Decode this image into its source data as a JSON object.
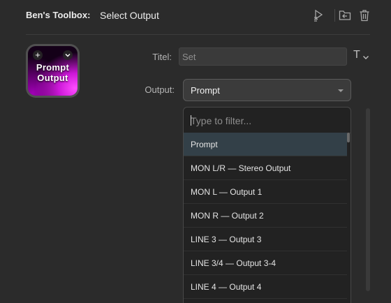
{
  "header": {
    "plugin_name": "Ben's Toolbox:",
    "action_name": "Select Output",
    "icons": [
      "multi-action-icon",
      "folder-import-icon",
      "trash-icon"
    ]
  },
  "key": {
    "line1": "Prompt",
    "line2": "Output",
    "add_icon": "+",
    "chevron_icon": "chevron-down-icon"
  },
  "form": {
    "title_label": "Titel:",
    "title_value": "Set",
    "title_menu_glyph": "T",
    "output_label": "Output:",
    "output_selected": "Prompt"
  },
  "dropdown": {
    "filter_placeholder": "Type to filter...",
    "options": [
      {
        "label": "Prompt",
        "selected": true
      },
      {
        "label": "MON L/R — Stereo Output",
        "selected": false
      },
      {
        "label": "MON L — Output 1",
        "selected": false
      },
      {
        "label": "MON R — Output 2",
        "selected": false
      },
      {
        "label": "LINE 3 — Output 3",
        "selected": false
      },
      {
        "label": "LINE 3/4 — Output 3-4",
        "selected": false
      },
      {
        "label": "LINE 4 — Output 4",
        "selected": false
      }
    ]
  },
  "colors": {
    "background": "#2b2b2b",
    "selected_option": "#334048",
    "key_magenta": "#cc17d8"
  }
}
